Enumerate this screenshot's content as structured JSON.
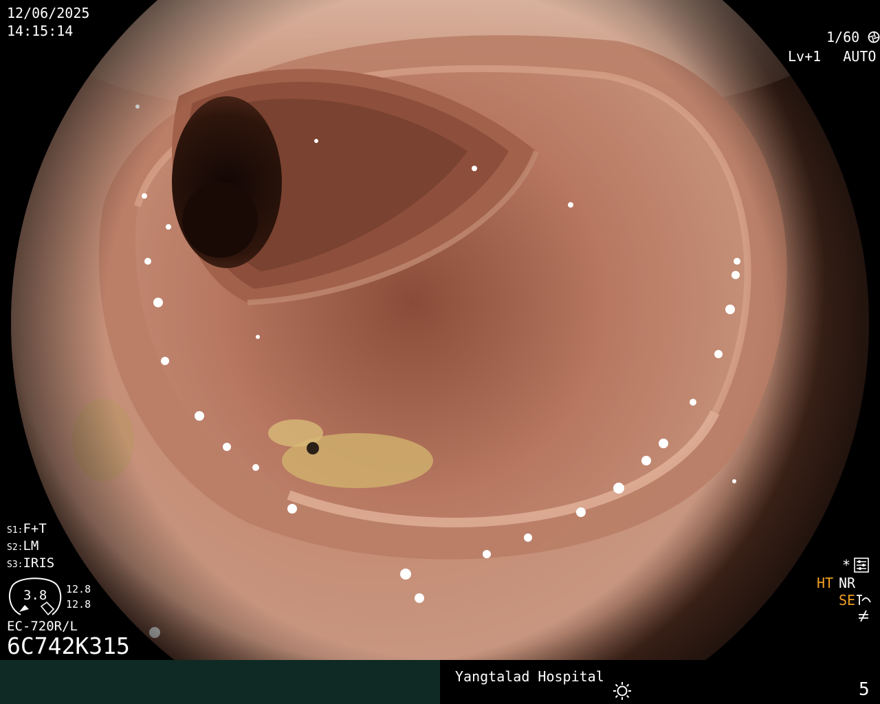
{
  "image": {
    "description": "Endoscopic colonoscopy view of colon lumen with haustral folds",
    "colors": {
      "mucosa_outer": "#d8aa92",
      "mucosa_mid": "#b57660",
      "mucosa_deep": "#7a4330",
      "lumen_dark": "#1e0d08",
      "residue": "#d6b470",
      "status_left_bg": "#0f2a24",
      "highlight_orange": "#f0a020"
    }
  },
  "overlay": {
    "date": "12/06/2025",
    "time": "14:15:14",
    "shutter": "1/60",
    "shutter_icon": "aperture-icon",
    "level": "Lv+1",
    "exposure_mode": "AUTO",
    "exposure_icon": "iris-icon",
    "s1_label": "S1:",
    "s1_value": "F+T",
    "s2_label": "S2:",
    "s2_value": "LM",
    "s3_label": "S3:",
    "s3_value": "IRIS",
    "gauge_value": "3.8",
    "gauge_top": "12.8",
    "gauge_bottom": "12.8",
    "scope_model": "EC-720R/L",
    "scope_serial": "6C742K315",
    "star": "*",
    "mode_ht": "HT",
    "mode_nr": "NR",
    "mode_se": "SE",
    "mode_icons": [
      "settings-icon",
      "se-curve-icon",
      "not-equal-icon"
    ]
  },
  "status": {
    "hospital": "Yangtalad Hospital",
    "brightness_icon": "sun-icon",
    "counter": "5"
  }
}
